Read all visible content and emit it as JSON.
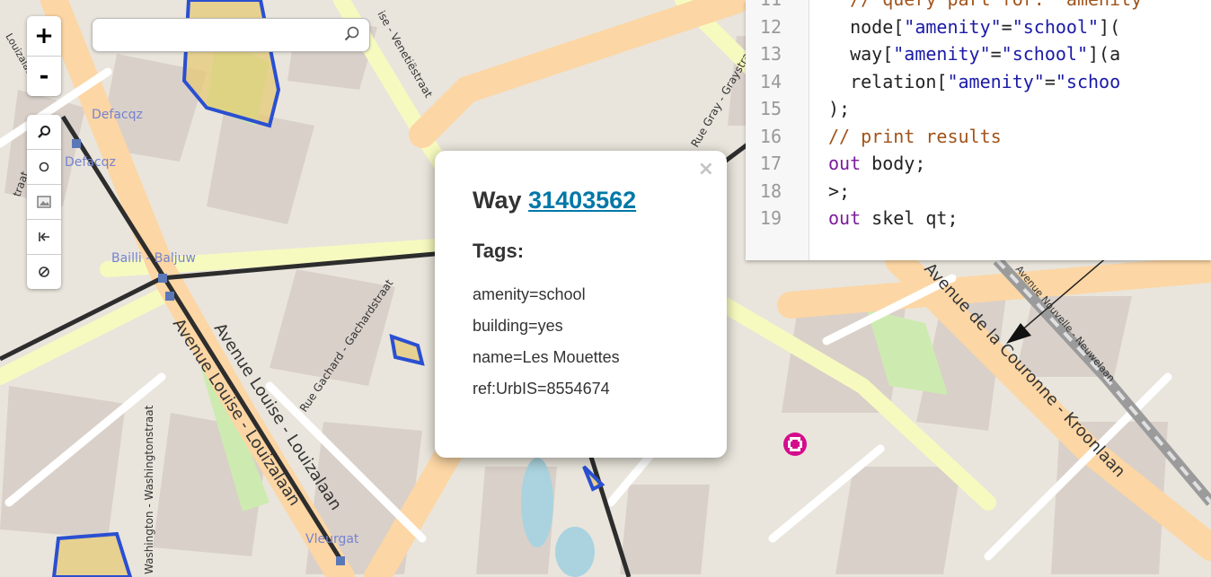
{
  "map": {
    "labels": {
      "avenue_louise": "Avenue Louise - Louizalaan",
      "couronne": "Avenue de la Couronne - Kroonlaan",
      "nouvelle": "Avenue Nouvelle - Neuwelaan",
      "gachard": "Rue Gachard - Gachardstraat",
      "gray": "Rue Gray - Graystraat",
      "washington": "Washington - Washingtonstraat",
      "venetie": "ise - Venetiëstraat",
      "defacqz1": "Defacqz",
      "defacqz2": "Defacqz",
      "bailli": "Bailli - Baljuw",
      "vleurgat": "Vleurgat",
      "straat": "traat",
      "louizalaan_small": "Louizalaan"
    },
    "colors": {
      "background": "#e9e5dc",
      "block": "#d9d0c9",
      "primary_road": "#fcd6a4",
      "secondary_road": "#f7fabf",
      "highlight": "#2a4fd1",
      "park": "#cdebb0",
      "hospital": "#d40d8c"
    }
  },
  "controls": {
    "zoom_in": "+",
    "zoom_out": "-",
    "search_placeholder": "",
    "tools": [
      {
        "name": "zoom-to-data",
        "glyph": "⌕"
      },
      {
        "name": "locate",
        "glyph": "○"
      },
      {
        "name": "map-data",
        "glyph": "▭"
      },
      {
        "name": "first-result",
        "glyph": "⇤"
      },
      {
        "name": "clear",
        "glyph": "⊘"
      }
    ]
  },
  "code": {
    "lines": [
      {
        "n": "11",
        "parts": [
          {
            "t": "  // query part for: “amenity",
            "c": "cmt"
          }
        ]
      },
      {
        "n": "12",
        "parts": [
          {
            "t": "  node[",
            "c": "plain"
          },
          {
            "t": "\"amenity\"",
            "c": "str"
          },
          {
            "t": "=",
            "c": "plain"
          },
          {
            "t": "\"school\"",
            "c": "str"
          },
          {
            "t": "](",
            "c": "plain"
          }
        ]
      },
      {
        "n": "13",
        "parts": [
          {
            "t": "  way[",
            "c": "plain"
          },
          {
            "t": "\"amenity\"",
            "c": "str"
          },
          {
            "t": "=",
            "c": "plain"
          },
          {
            "t": "\"school\"",
            "c": "str"
          },
          {
            "t": "](a",
            "c": "plain"
          }
        ]
      },
      {
        "n": "14",
        "parts": [
          {
            "t": "  relation[",
            "c": "plain"
          },
          {
            "t": "\"amenity\"",
            "c": "str"
          },
          {
            "t": "=",
            "c": "plain"
          },
          {
            "t": "\"schoo",
            "c": "str"
          }
        ]
      },
      {
        "n": "15",
        "parts": [
          {
            "t": ");",
            "c": "plain"
          }
        ]
      },
      {
        "n": "16",
        "parts": [
          {
            "t": "// print results",
            "c": "cmt"
          }
        ]
      },
      {
        "n": "17",
        "parts": [
          {
            "t": "out",
            "c": "kw"
          },
          {
            "t": " body;",
            "c": "plain"
          }
        ]
      },
      {
        "n": "18",
        "parts": [
          {
            "t": ">;",
            "c": "plain"
          }
        ]
      },
      {
        "n": "19",
        "parts": [
          {
            "t": "out",
            "c": "kw"
          },
          {
            "t": " skel qt;",
            "c": "plain"
          }
        ]
      }
    ]
  },
  "popup": {
    "close": "×",
    "title_prefix": "Way",
    "way_id": "31403562",
    "tags_heading": "Tags:",
    "tags": [
      "amenity=school",
      "building=yes",
      "name=Les Mouettes",
      "ref:UrbIS=8554674"
    ]
  }
}
